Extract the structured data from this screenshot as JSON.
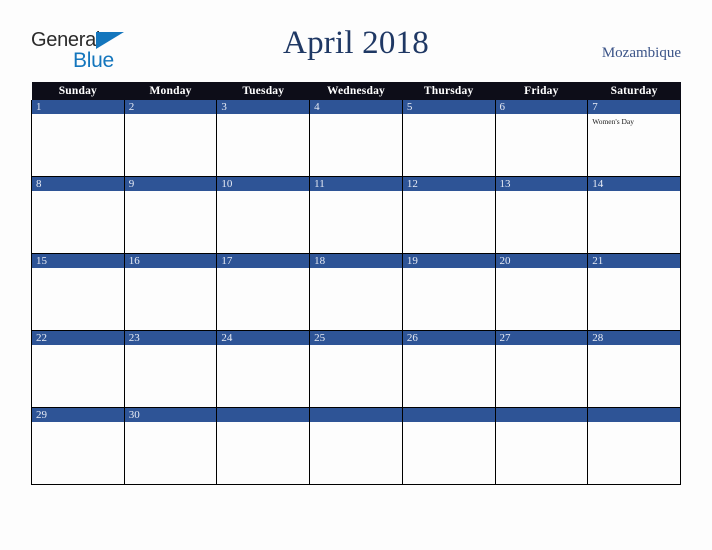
{
  "brand": {
    "name_part1": "General",
    "name_part2": "Blue",
    "triangle_icon": "brand-triangle-icon",
    "color_dark": "#2b2b2b",
    "color_blue": "#1476bd"
  },
  "header": {
    "title": "April 2018",
    "country": "Mozambique",
    "title_color": "#1f3864",
    "country_color": "#3b5488"
  },
  "calendar": {
    "month": "April",
    "year": "2018",
    "header_bg": "#0d0d18",
    "daynum_bg": "#2e5496",
    "daynum_color": "#e8ecf5",
    "weekdays": [
      "Sunday",
      "Monday",
      "Tuesday",
      "Wednesday",
      "Thursday",
      "Friday",
      "Saturday"
    ],
    "weeks": [
      [
        {
          "day": "1",
          "holiday": ""
        },
        {
          "day": "2",
          "holiday": ""
        },
        {
          "day": "3",
          "holiday": ""
        },
        {
          "day": "4",
          "holiday": ""
        },
        {
          "day": "5",
          "holiday": ""
        },
        {
          "day": "6",
          "holiday": ""
        },
        {
          "day": "7",
          "holiday": "Women's Day"
        }
      ],
      [
        {
          "day": "8",
          "holiday": ""
        },
        {
          "day": "9",
          "holiday": ""
        },
        {
          "day": "10",
          "holiday": ""
        },
        {
          "day": "11",
          "holiday": ""
        },
        {
          "day": "12",
          "holiday": ""
        },
        {
          "day": "13",
          "holiday": ""
        },
        {
          "day": "14",
          "holiday": ""
        }
      ],
      [
        {
          "day": "15",
          "holiday": ""
        },
        {
          "day": "16",
          "holiday": ""
        },
        {
          "day": "17",
          "holiday": ""
        },
        {
          "day": "18",
          "holiday": ""
        },
        {
          "day": "19",
          "holiday": ""
        },
        {
          "day": "20",
          "holiday": ""
        },
        {
          "day": "21",
          "holiday": ""
        }
      ],
      [
        {
          "day": "22",
          "holiday": ""
        },
        {
          "day": "23",
          "holiday": ""
        },
        {
          "day": "24",
          "holiday": ""
        },
        {
          "day": "25",
          "holiday": ""
        },
        {
          "day": "26",
          "holiday": ""
        },
        {
          "day": "27",
          "holiday": ""
        },
        {
          "day": "28",
          "holiday": ""
        }
      ],
      [
        {
          "day": "29",
          "holiday": ""
        },
        {
          "day": "30",
          "holiday": ""
        },
        {
          "day": "",
          "holiday": ""
        },
        {
          "day": "",
          "holiday": ""
        },
        {
          "day": "",
          "holiday": ""
        },
        {
          "day": "",
          "holiday": ""
        },
        {
          "day": "",
          "holiday": ""
        }
      ]
    ]
  }
}
